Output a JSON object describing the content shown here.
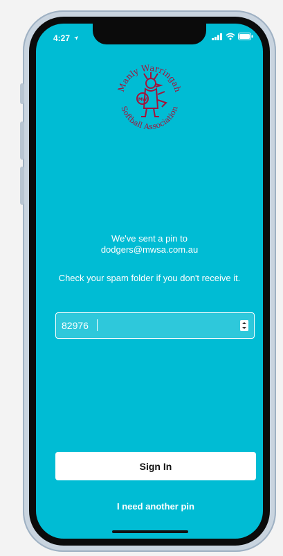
{
  "status_bar": {
    "time": "4:27",
    "location_icon": "location-arrow-icon",
    "signal_icon": "signal-bars-icon",
    "wifi_icon": "wifi-icon",
    "battery_icon": "battery-icon"
  },
  "logo": {
    "text_top": "Manly Warringah",
    "text_bottom": "Softball Association",
    "badge_text": "MW",
    "color": "#a3123a"
  },
  "message": {
    "line1": "We've sent a pin to",
    "email": "dodgers@mwsa.com.au",
    "spam_note": "Check your spam folder if you don't receive it."
  },
  "pin_input": {
    "value": "82976"
  },
  "buttons": {
    "sign_in": "Sign In",
    "another_pin": "I need another pin"
  },
  "colors": {
    "background": "#00bcd4",
    "button": "#ffffff",
    "logo": "#a3123a"
  }
}
